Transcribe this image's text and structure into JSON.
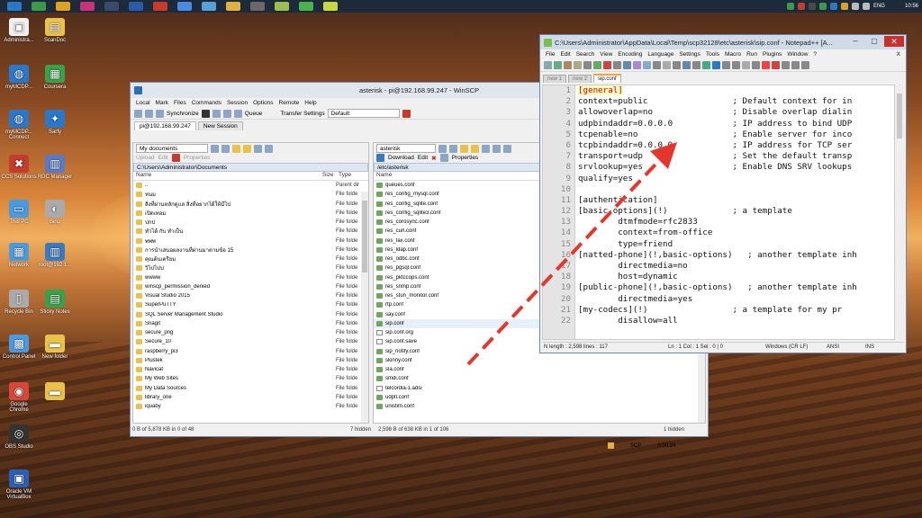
{
  "tray": {
    "lang": "ENG",
    "time": "10:56"
  },
  "desktop_icons": [
    {
      "label": "Administra...",
      "color": "#f0f0f0",
      "glyph": "▣"
    },
    {
      "label": "ScanDoc",
      "color": "#e9c24e",
      "glyph": "▤"
    },
    {
      "label": "myMCDP...",
      "color": "#2a78c8",
      "glyph": "◍"
    },
    {
      "label": "Coursera",
      "color": "#3aa04a",
      "glyph": "▦"
    },
    {
      "label": "myMCDP... Connect",
      "color": "#2a78c8",
      "glyph": "◍"
    },
    {
      "label": "Sarfy",
      "color": "#2a78c8",
      "glyph": "✦"
    },
    {
      "label": "CCS Solutions",
      "color": "#c43c2c",
      "glyph": "✖"
    },
    {
      "label": "RDC Manager",
      "color": "#5a7ac8",
      "glyph": "▥"
    },
    {
      "label": "This PC",
      "color": "#4a9ae0",
      "glyph": "▭"
    },
    {
      "label": "Bing",
      "color": "#aaaaaa",
      "glyph": "◐"
    },
    {
      "label": "Network",
      "color": "#4a9ae0",
      "glyph": "▦"
    },
    {
      "label": "root@192.1...",
      "color": "#3a7ac0",
      "glyph": "▥"
    },
    {
      "label": "Recycle Bin",
      "color": "#aaaaaa",
      "glyph": "▯"
    },
    {
      "label": "Sticky Notes",
      "color": "#3aa04a",
      "glyph": "▤"
    },
    {
      "label": "Control Panel",
      "color": "#4a9ae0",
      "glyph": "▩"
    },
    {
      "label": "New folder",
      "color": "#e9c24e",
      "glyph": "▬"
    },
    {
      "label": "Google Chrome",
      "color": "#d8463a",
      "glyph": "◉"
    },
    {
      "label": "",
      "color": "#e9c24e",
      "glyph": "▬"
    },
    {
      "label": "OBS Studio",
      "color": "#333333",
      "glyph": "◎"
    },
    {
      "label": "Oracle VM VirtualBox",
      "color": "#2a5fb5",
      "glyph": "▣"
    }
  ],
  "winscp": {
    "title": "asterisk - pi@192.168.99.247 - WinSCP",
    "menu": [
      "Local",
      "Mark",
      "Files",
      "Commands",
      "Session",
      "Options",
      "Remote",
      "Help"
    ],
    "toolbar": {
      "synchronize": "Synchronize",
      "queue": "Queue",
      "transfer_settings": "Transfer Settings",
      "transfer_value": "Default"
    },
    "tabs": {
      "session": "pi@192.168.99.247",
      "new_session": "New Session"
    },
    "left": {
      "location": "My documents",
      "upload": "Upload",
      "edit": "Edit",
      "properties": "Properties",
      "path": "C:\\Users\\Administrator\\Documents",
      "col_name": "Name",
      "col_size": "Size",
      "col_type": "Type",
      "rows": [
        {
          "name": "..",
          "type": "Parent dir"
        },
        {
          "name": "หนม",
          "type": "File folde"
        },
        {
          "name": "สิ่งที่ผ่านหลักดูแล สิ่งที่อยากได้ให้มีไป",
          "type": "File folde"
        },
        {
          "name": "เปิดเทอม",
          "type": "File folde"
        },
        {
          "name": "ปกป",
          "type": "File folde"
        },
        {
          "name": "ทำได้ กับ ทำเป็น",
          "type": "File folde"
        },
        {
          "name": "พพพ",
          "type": "File folde"
        },
        {
          "name": "การนำเสนอผลงานที่ผ่านมาตามข้อ 15",
          "type": "File folde"
        },
        {
          "name": "คุณต้นเตรียม",
          "type": "File folde"
        },
        {
          "name": "วิไปไปป",
          "type": "File folde"
        },
        {
          "name": "wwww",
          "type": "File folde"
        },
        {
          "name": "winscp_permission_denied",
          "type": "File folde"
        },
        {
          "name": "Visual Studio 2015",
          "type": "File folde"
        },
        {
          "name": "SuperPuTTY",
          "type": "File folde"
        },
        {
          "name": "SQL Server Management Studio",
          "type": "File folde"
        },
        {
          "name": "Snagit",
          "type": "File folde"
        },
        {
          "name": "secure_png",
          "type": "File folde"
        },
        {
          "name": "Secure_10",
          "type": "File folde"
        },
        {
          "name": "raspberry_pi3",
          "type": "File folde"
        },
        {
          "name": "Plustek",
          "type": "File folde"
        },
        {
          "name": "Navicat",
          "type": "File folde"
        },
        {
          "name": "My Web Sites",
          "type": "File folde"
        },
        {
          "name": "My Data Sources",
          "type": "File folde"
        },
        {
          "name": "library_one",
          "type": "File folde"
        },
        {
          "name": "iquaby",
          "type": "File folde"
        }
      ],
      "status": "0 B of 5,878 KB in 0 of 48",
      "hidden": "7 hidden"
    },
    "right": {
      "location": "asterisk",
      "download": "Download",
      "edit": "Edit",
      "properties": "Properties",
      "path": "/etc/asterisk",
      "col_name": "Name",
      "rows": [
        {
          "name": "queues.conf",
          "kind": "cfg"
        },
        {
          "name": "res_config_mysql.conf",
          "kind": "cfg"
        },
        {
          "name": "res_config_sqlite.conf",
          "kind": "cfg"
        },
        {
          "name": "res_config_sqlite3.conf",
          "kind": "cfg"
        },
        {
          "name": "res_corosync.conf",
          "kind": "cfg"
        },
        {
          "name": "res_curl.conf",
          "kind": "cfg"
        },
        {
          "name": "res_fax.conf",
          "kind": "cfg"
        },
        {
          "name": "res_ldap.conf",
          "kind": "cfg"
        },
        {
          "name": "res_odbc.conf",
          "kind": "cfg"
        },
        {
          "name": "res_pgsql.conf",
          "kind": "cfg"
        },
        {
          "name": "res_pktccops.conf",
          "kind": "cfg"
        },
        {
          "name": "res_snmp.conf",
          "kind": "cfg"
        },
        {
          "name": "res_stun_monitor.conf",
          "kind": "cfg"
        },
        {
          "name": "rtp.conf",
          "kind": "cfg"
        },
        {
          "name": "say.conf",
          "kind": "cfg"
        },
        {
          "name": "sip.conf",
          "kind": "cfg",
          "selected": true
        },
        {
          "name": "sip.conf.org",
          "kind": "file"
        },
        {
          "name": "sip.conf.save",
          "kind": "file"
        },
        {
          "name": "sip_notify.conf",
          "kind": "cfg"
        },
        {
          "name": "skinny.conf",
          "kind": "cfg"
        },
        {
          "name": "sla.conf",
          "kind": "cfg"
        },
        {
          "name": "smdi.conf",
          "kind": "cfg"
        },
        {
          "name": "telcordia-1.adsi",
          "kind": "file"
        },
        {
          "name": "udptl.conf",
          "kind": "cfg"
        },
        {
          "name": "unistim.conf",
          "kind": "cfg"
        }
      ],
      "status": "2,598 B of 638 KB in 1 of 106",
      "hidden": "1 hidden"
    },
    "bottom": {
      "protocol": "SCP",
      "elapsed": "0:00:24"
    }
  },
  "npp": {
    "title": "C:\\Users\\Administrator\\AppData\\Local\\Temp\\scp32128\\etc\\asterisk\\sip.conf - Notepad++ [A...",
    "menu": [
      "File",
      "Edit",
      "Search",
      "View",
      "Encoding",
      "Language",
      "Settings",
      "Tools",
      "Macro",
      "Run",
      "Plugins",
      "Window",
      "?"
    ],
    "close_x": "X",
    "tabs": [
      "new 1",
      "new 2",
      "sip.conf"
    ],
    "lines": [
      "[general]",
      "context=public                 ; Default context for in",
      "allowoverlap=no                ; Disable overlap dialin",
      "udpbindaddr=0.0.0.0            ; IP address to bind UDP",
      "tcpenable=no                   ; Enable server for inco",
      "tcpbindaddr=0.0.0.0            ; IP address for TCP ser",
      "transport=udp                  ; Set the default transp",
      "srvlookup=yes                  ; Enable DNS SRV lookups",
      "qualify=yes",
      "",
      "[authentication]",
      "[basic-options](!)             ; a template",
      "        dtmfmode=rfc2833",
      "        context=from-office",
      "        type=friend",
      "[natted-phone](!,basic-options)   ; another template inh",
      "        directmedia=no",
      "        host=dynamic",
      "[public-phone](!,basic-options)   ; another template inh",
      "        directmedia=yes",
      "[my-codecs](!)                 ; a template for my pr",
      "        disallow=all"
    ],
    "status": {
      "length": "N length : 2,598   lines : 117",
      "pos": "Ln : 1   Col : 1   Sel : 0 | 0",
      "eol": "Windows (CR LF)",
      "enc": "ANSI",
      "mode": "INS"
    }
  }
}
